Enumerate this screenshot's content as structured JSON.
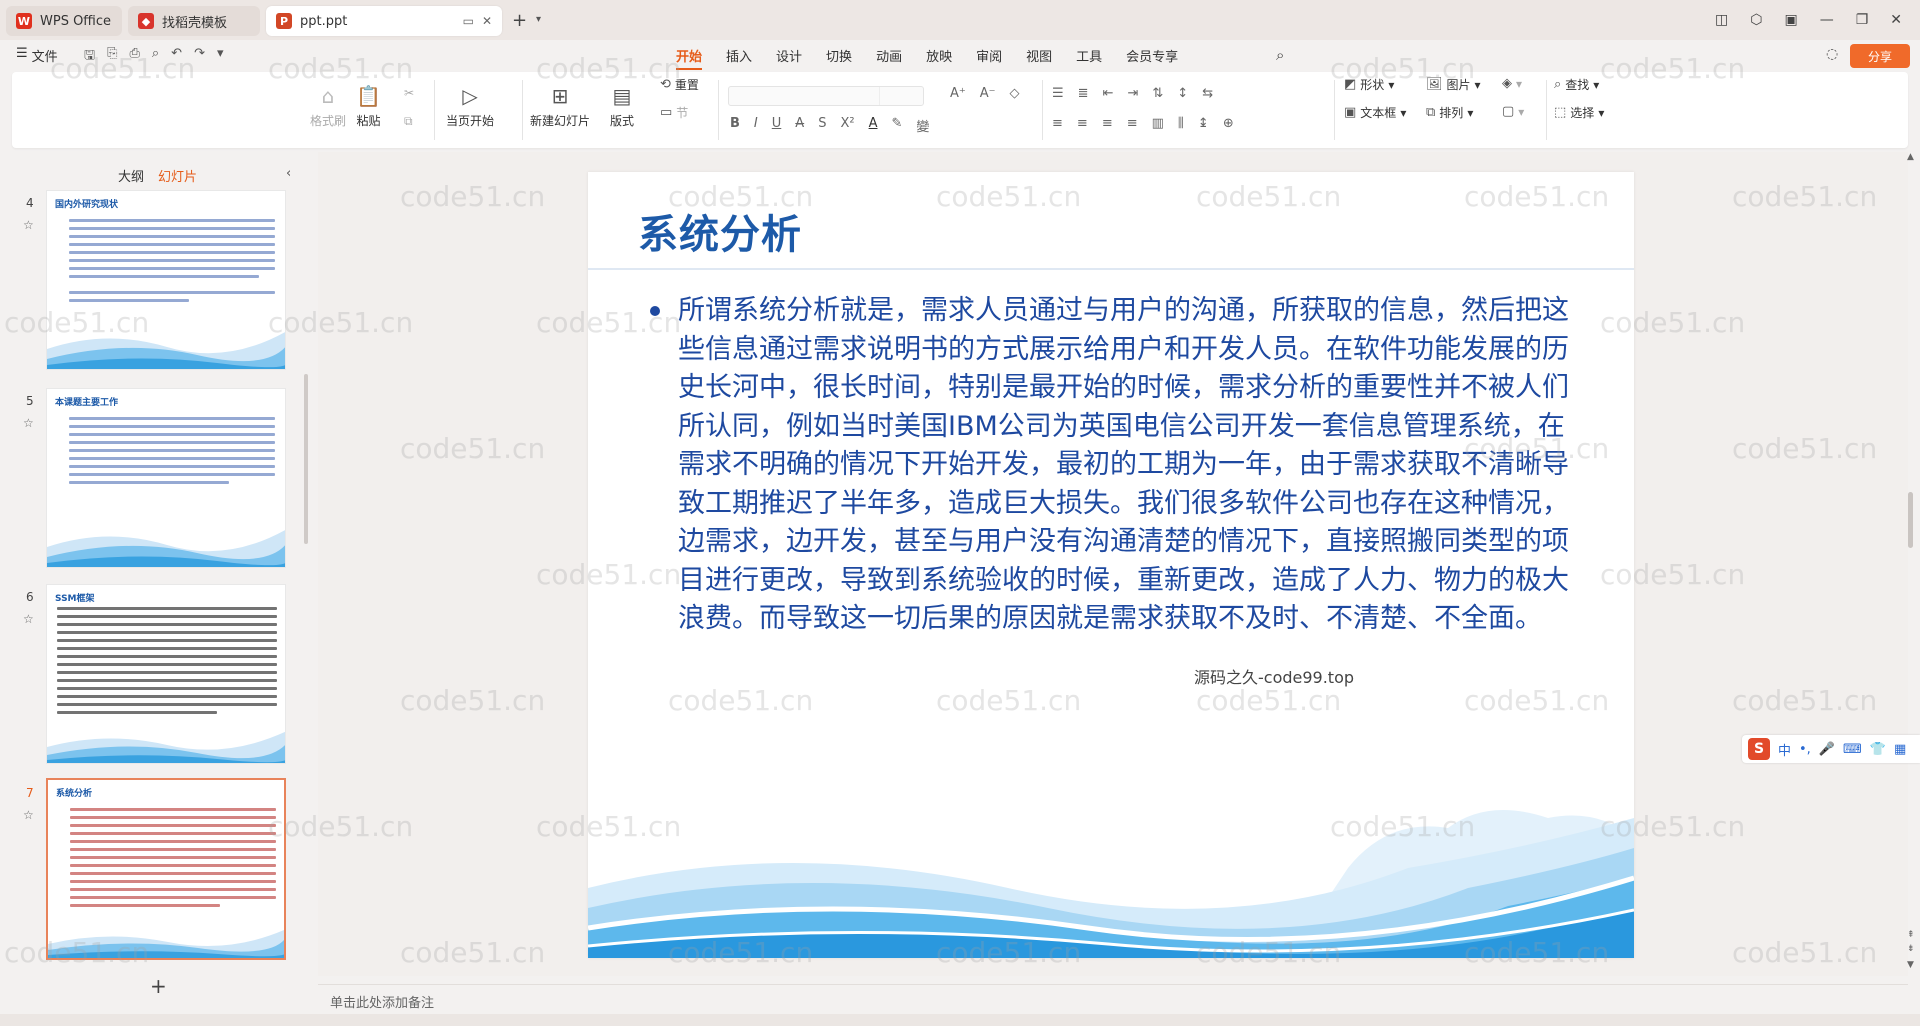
{
  "tabs": [
    {
      "label": "WPS Office",
      "logo": "W"
    },
    {
      "label": "找稻壳模板",
      "logo": "D"
    },
    {
      "label": "ppt.ppt",
      "logo": "P"
    }
  ],
  "menu": {
    "file": "文件",
    "tabs": [
      "开始",
      "插入",
      "设计",
      "切换",
      "动画",
      "放映",
      "审阅",
      "视图",
      "工具",
      "会员专享"
    ],
    "active": "开始",
    "share": "分享"
  },
  "ribbon": {
    "format_painter": "格式刷",
    "paste": "粘贴",
    "play_current": "当页开始",
    "new_slide": "新建幻灯片",
    "layout": "版式",
    "reset": "重置",
    "section": "节",
    "shape": "形状",
    "picture": "图片",
    "textbox": "文本框",
    "arrange": "排列",
    "find": "查找",
    "select": "选择"
  },
  "left_panel": {
    "tab_outline": "大纲",
    "tab_slides": "幻灯片",
    "thumbs": [
      {
        "num": "4",
        "title": "国内外研究现状"
      },
      {
        "num": "5",
        "title": "本课题主要工作"
      },
      {
        "num": "6",
        "title": "SSM框架"
      },
      {
        "num": "7",
        "title": "系统分析"
      }
    ]
  },
  "slide": {
    "title": "系统分析",
    "body": "所谓系统分析就是，需求人员通过与用户的沟通，所获取的信息，然后把这些信息通过需求说明书的方式展示给用户和开发人员。在软件功能发展的历史长河中，很长时间，特别是最开始的时候，需求分析的重要性并不被人们所认同，例如当时美国IBM公司为英国电信公司开发一套信息管理系统，在需求不明确的情况下开始开发，最初的工期为一年，由于需求获取不清晰导致工期推迟了半年多，造成巨大损失。我们很多软件公司也存在这种情况，边需求，边开发，甚至与用户没有沟通清楚的情况下，直接照搬同类型的项目进行更改，导致到系统验收的时候，重新更改，造成了人力、物力的极大浪费。而导致这一切后果的原因就是需求获取不及时、不清楚、不全面。"
  },
  "overlay_text": "源码之久-code99.top",
  "watermark": "code51.cn",
  "notes_placeholder": "单击此处添加备注",
  "ime": {
    "lang": "中"
  },
  "colors": {
    "accent": "#e65c1a",
    "title_blue": "#1d5aa8",
    "body_blue": "#1e49a0"
  }
}
